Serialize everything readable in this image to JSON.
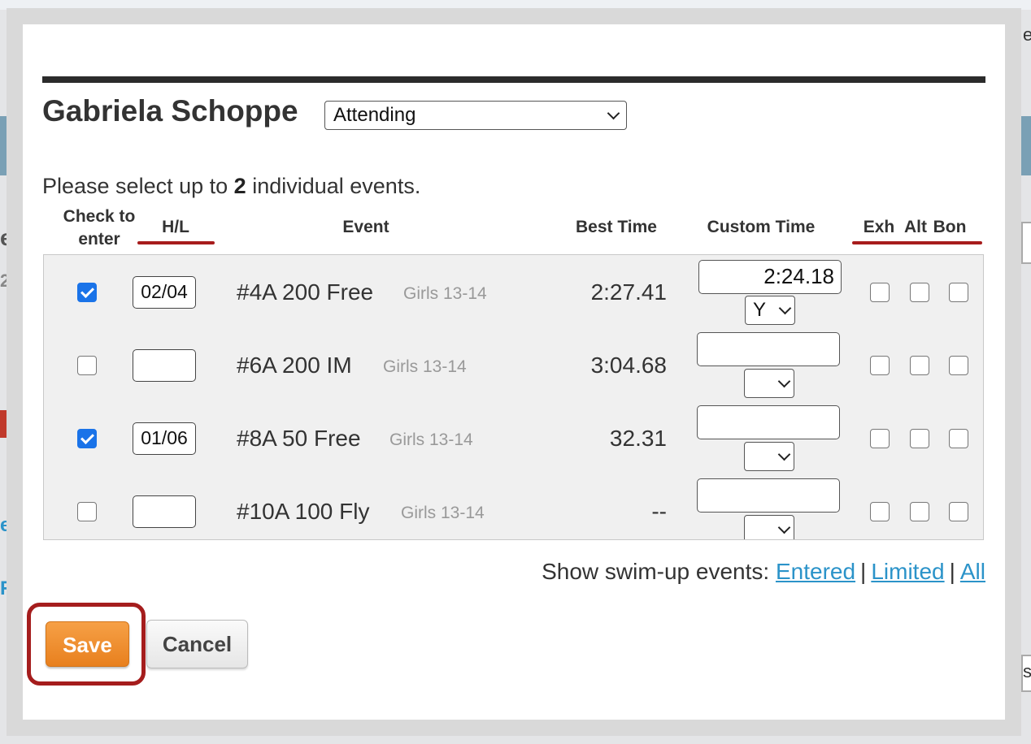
{
  "background": {
    "frag_e": "e",
    "frag_2": "2",
    "frag_s": "s",
    "frag_r": "R",
    "frag_e2": "e",
    "frag_es": "s"
  },
  "athlete": {
    "name": "Gabriela Schoppe",
    "status": "Attending"
  },
  "instructions": {
    "prefix": "Please select up to ",
    "count": "2",
    "suffix": " individual events."
  },
  "columns": {
    "check": "Check to enter",
    "hl": "H/L",
    "event": "Event",
    "best_time": "Best Time",
    "custom_time": "Custom Time",
    "exh": "Exh",
    "alt": "Alt",
    "bon": "Bon"
  },
  "events": [
    {
      "checked": true,
      "hl": "02/04",
      "name": "#4A 200 Free",
      "group": "Girls 13-14",
      "best": "2:27.41",
      "custom": "2:24.18",
      "custom_sel": "Y"
    },
    {
      "checked": false,
      "hl": "",
      "name": "#6A 200 IM",
      "group": "Girls 13-14",
      "best": "3:04.68",
      "custom": "",
      "custom_sel": ""
    },
    {
      "checked": true,
      "hl": "01/06",
      "name": "#8A 50 Free",
      "group": "Girls 13-14",
      "best": "32.31",
      "custom": "",
      "custom_sel": ""
    },
    {
      "checked": false,
      "hl": "",
      "name": "#10A 100 Fly",
      "group": "Girls 13-14",
      "best": "--",
      "custom": "",
      "custom_sel": ""
    }
  ],
  "swimup": {
    "label": "Show swim-up events:",
    "entered": "Entered",
    "limited": "Limited",
    "all": "All",
    "separator": "|"
  },
  "buttons": {
    "save": "Save",
    "cancel": "Cancel"
  },
  "colors": {
    "accent_underline": "#a71c1c",
    "save_button": "#ef8f2e",
    "link": "#2b93c9",
    "checkbox_on": "#1a73e8"
  }
}
